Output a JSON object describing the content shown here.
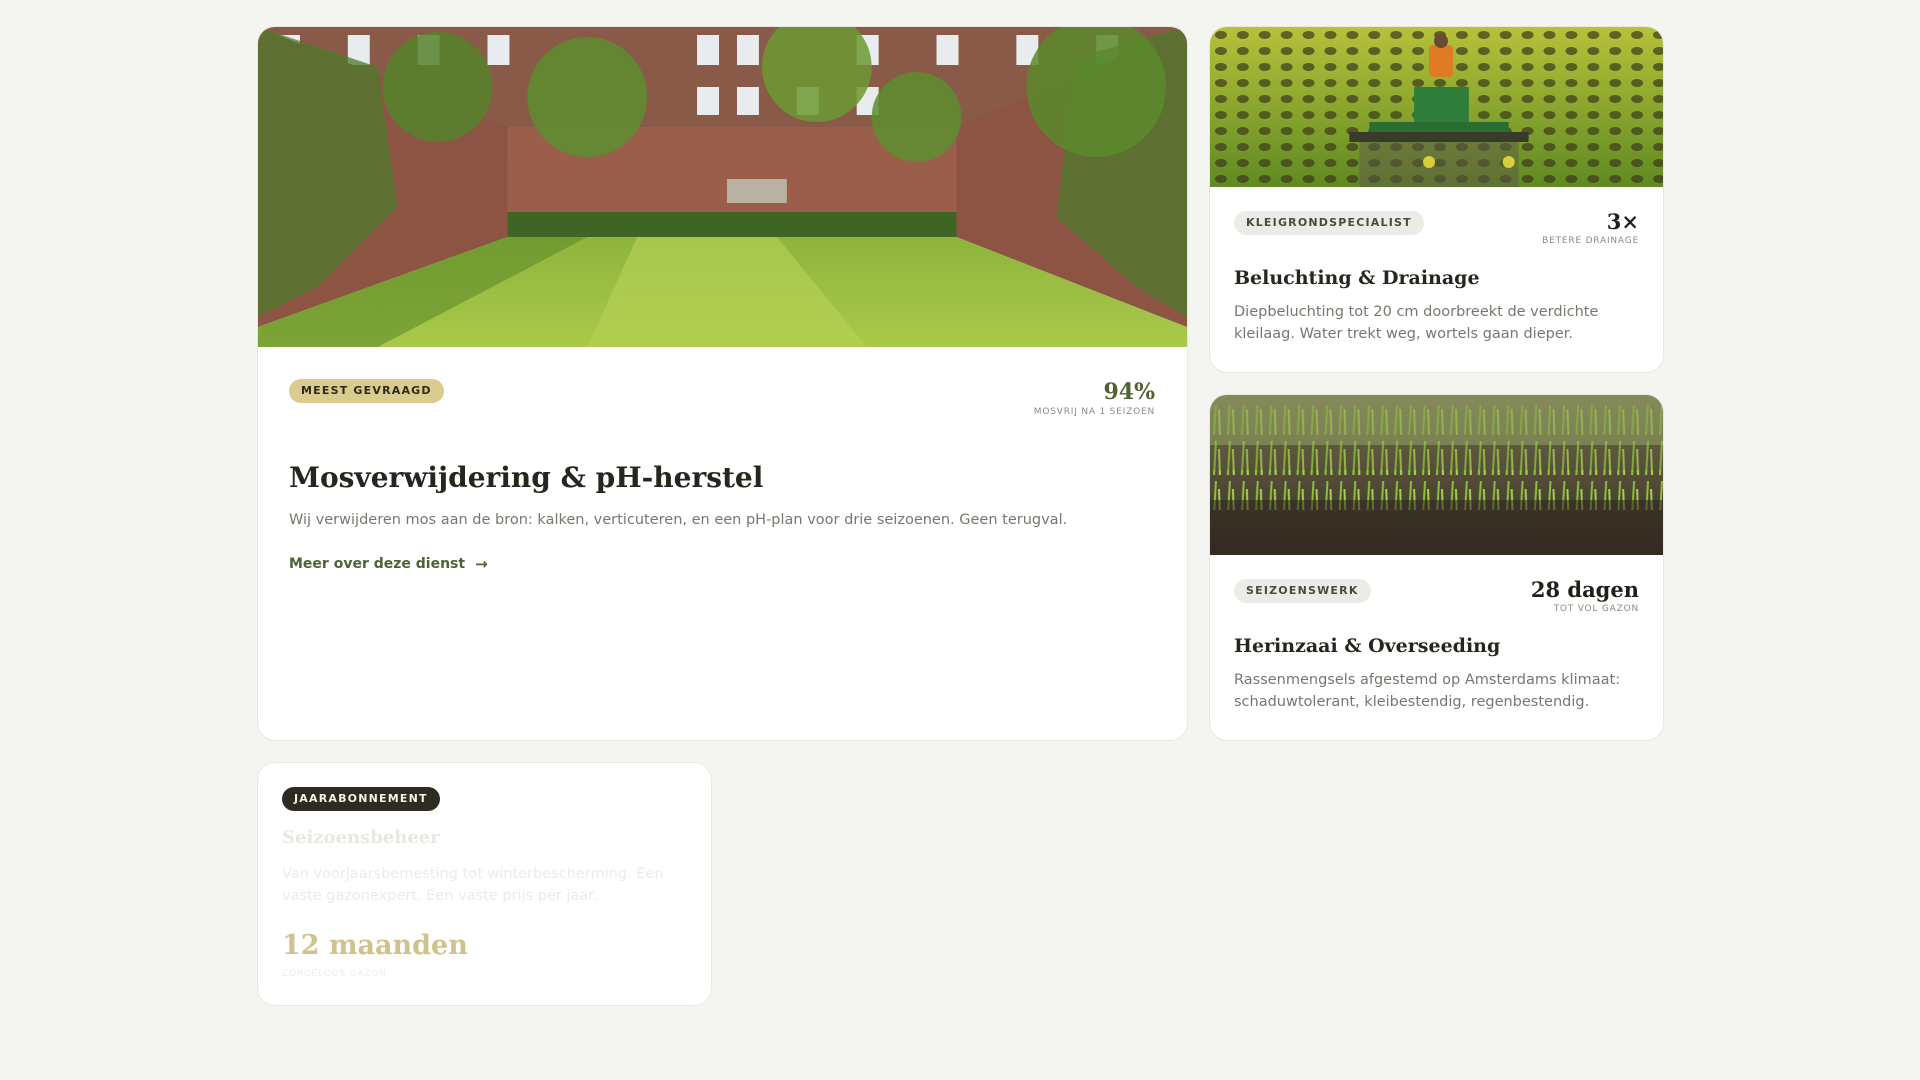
{
  "cards": {
    "main": {
      "image_alt": "Tuin met gazon tussen bakstenen muren",
      "badge": "MEEST GEVRAAGD",
      "stat_value": "94%",
      "stat_label": "MOSVRIJ NA 1 SEIZOEN",
      "title": "Mosverwijdering & pH-herstel",
      "description": "Wij verwijderen mos aan de bron: kalken, verticuteren, en een pH-plan voor drie seizoenen. Geen terugval.",
      "link_label": "Meer over deze dienst",
      "link_icon": "arrow-right-icon"
    },
    "drainage": {
      "image_alt": "Tractor belucht het gazon",
      "badge": "KLEIGRONDSPECIALIST",
      "stat_value": "3×",
      "stat_label": "BETERE DRAINAGE",
      "title": "Beluchting & Drainage",
      "description": "Diepbeluchting tot 20 cm doorbreekt de verdichte kleilaag. Water trekt weg, wortels gaan dieper."
    },
    "seeding": {
      "image_alt": "Jonge grasscheuten in aarde",
      "badge": "SEIZOENSWERK",
      "stat_value": "28 dagen",
      "stat_label": "TOT VOL GAZON",
      "title": "Herinzaai & Overseeding",
      "description": "Rassenmengsels afgestemd op Amsterdams klimaat: schaduwtolerant, kleibestendig, regenbestendig."
    },
    "season": {
      "badge": "JAARABONNEMENT",
      "title": "Seizoensbeheer",
      "description": "Van voorjaarsbemesting tot winterbescherming. Een vaste gazonexpert. Een vaste prijs per jaar.",
      "stat_value": "12 maanden",
      "stat_label": "ZORGELOOS GAZON"
    }
  },
  "colors": {
    "page_background": "#f4f4f0",
    "accent_green": "#4f6234",
    "badge_gold": "#d9cc8e",
    "badge_dark": "#2f2a22"
  }
}
